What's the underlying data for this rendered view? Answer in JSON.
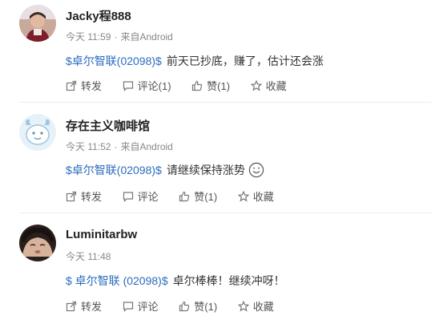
{
  "posts": [
    {
      "username": "Jacky程888",
      "time": "今天 11:59",
      "source": "来自Android",
      "stock": "$卓尔智联(02098)$",
      "text": "前天已抄底，赚了，估计还会涨",
      "actions": {
        "repost": "转发",
        "comment": "评论(1)",
        "like": "赞(1)",
        "favorite": "收藏"
      }
    },
    {
      "username": "存在主义咖啡馆",
      "time": "今天 11:52",
      "source": "来自Android",
      "stock": "$卓尔智联(02098)$",
      "text": "请继续保持涨势",
      "actions": {
        "repost": "转发",
        "comment": "评论",
        "like": "赞(1)",
        "favorite": "收藏"
      }
    },
    {
      "username": "Luminitarbw",
      "time": "今天 11:48",
      "source": "",
      "stock": "$ 卓尔智联 (02098)$",
      "text": "卓尔棒棒！继续冲呀！",
      "actions": {
        "repost": "转发",
        "comment": "评论",
        "like": "赞(1)",
        "favorite": "收藏"
      }
    }
  ],
  "colors": {
    "link": "#2b6bbf",
    "text": "#333333",
    "meta": "#888888",
    "divider": "#eeeeee"
  }
}
